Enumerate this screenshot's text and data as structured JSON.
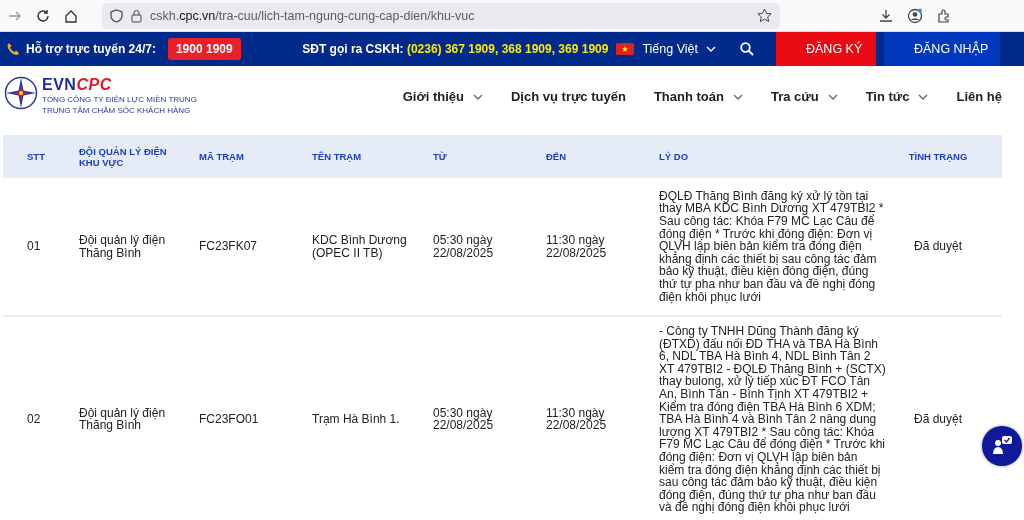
{
  "browser": {
    "url": "cskh.**cpc.vn**/tra-cuu/lich-tam-ngung-cung-cap-dien/khu-vuc"
  },
  "topbar": {
    "support_label": "Hỗ trợ trực tuyến 24/7:",
    "hotline": "1900 1909",
    "cskh_label": "SĐT gọi ra CSKH:",
    "cskh_numbers": "(0236) 367 1909, 368 1909, 369 1909",
    "language": "Tiếng Việt",
    "register": "ĐĂNG KÝ",
    "login": "ĐĂNG NHẬP"
  },
  "logo": {
    "brand_main": "EVN",
    "brand_accent": "CPC",
    "org_lines": [
      "TỔNG CÔNG TY ĐIỆN LỰC MIỀN TRUNG",
      "TRUNG TÂM CHĂM SÓC KHÁCH HÀNG"
    ]
  },
  "nav": [
    {
      "label": "Giới thiệu",
      "has_dropdown": true
    },
    {
      "label": "Dịch vụ trực tuyến",
      "has_dropdown": false
    },
    {
      "label": "Thanh toán",
      "has_dropdown": true
    },
    {
      "label": "Tra cứu",
      "has_dropdown": true
    },
    {
      "label": "Tin tức",
      "has_dropdown": true
    },
    {
      "label": "Liên hệ",
      "has_dropdown": false
    }
  ],
  "table": {
    "columns": [
      "STT",
      "ĐỘI QUẢN LÝ ĐIỆN KHU VỰC",
      "MÃ TRẠM",
      "TÊN TRẠM",
      "TỪ",
      "ĐẾN",
      "LÝ DO",
      "TÌNH TRẠNG"
    ],
    "rows": [
      {
        "stt": "01",
        "team": "Đội quản lý điện Thăng Bình",
        "code": "FC23FK07",
        "station": "KDC Bình Dương (OPEC II TB)",
        "from": "05:30 ngày 22/08/2025",
        "to": "11:30 ngày 22/08/2025",
        "reason": "ĐQLĐ Thăng Bình đăng ký xử lý tồn tại thay MBA KDC Bình Dương XT 479TBI2 * Sau công tác: Khóa F79 MC Lạc Câu để đóng điện * Trước khi đóng điện: Đơn vị QLVH lập biên bản kiểm tra đóng điện khẳng định các thiết bị sau công tác đảm bảo kỹ thuật, điều kiện đóng điện, đúng thứ tự pha như ban đầu và đề nghị đóng điện khôi phục lưới",
        "status": "Đã duyệt"
      },
      {
        "stt": "02",
        "team": "Đội quản lý điện Thăng Bình",
        "code": "FC23FO01",
        "station": "Trạm Hà Bình 1.",
        "from": "05:30 ngày 22/08/2025",
        "to": "11:30 ngày 22/08/2025",
        "reason": "- Công ty TNHH Dũng Thành đăng ký (ĐTXD) đấu nối ĐD THA và TBA Hà Bình 6, NDL TBA Hà Bình 4, NDL Bình Tân 2 XT 479TBI2 - ĐQLĐ Thăng Bình + (SCTX) thay bulong, xử lý tiếp xúc ĐT FCO Tân An, Bình Tân - Bình Tịnh XT 479TBI2 + Kiểm tra đóng điện TBA Hà Bình 6 XDM; TBA Hà Bình 4 và Bình Tân 2 nâng dung lượng XT 479TBI2 * Sau công tác: Khóa F79 MC Lạc Câu để đóng điện * Trước khi đóng điện: Đơn vị QLVH lập biên bản kiểm tra đóng điện khẳng định các thiết bị sau công tác đảm bảo kỹ thuật, điều kiện đóng điện, đúng thứ tự pha như ban đầu và đề nghị đóng điện khôi phục lưới",
        "status": "Đã duyệt"
      }
    ]
  }
}
